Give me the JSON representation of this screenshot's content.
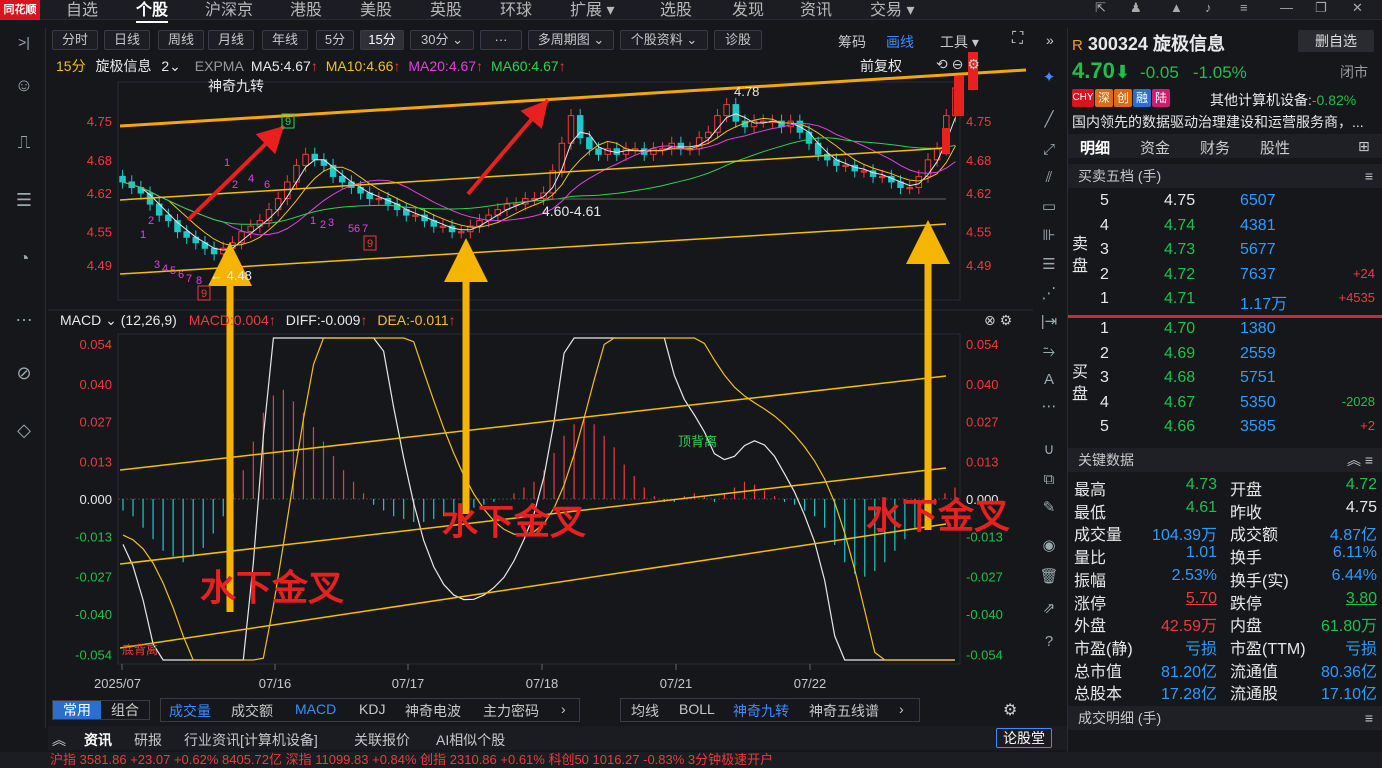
{
  "app": {
    "logo": "同花顺",
    "nav_tabs": [
      "自选",
      "个股",
      "沪深京",
      "港股",
      "美股",
      "英股",
      "环球",
      "扩展",
      "选股",
      "发现",
      "资讯",
      "交易"
    ],
    "active_nav": "个股"
  },
  "toolbar": {
    "periods": [
      "分时",
      "日线",
      "周线",
      "月线",
      "年线",
      "5分",
      "15分",
      "30分",
      "多周期图",
      "个股资料",
      "诊股"
    ],
    "active_period": "15分",
    "right_items": [
      "筹码",
      "画线",
      "工具"
    ]
  },
  "chart_header": {
    "period": "15分",
    "name": "旋极信息",
    "count": "2",
    "indicator": "EXPMA",
    "ma5": "MA5:4.67",
    "ma10": "MA10:4.66",
    "ma20": "MA20:4.67",
    "ma60": "MA60:4.67",
    "adjust": "前复权",
    "sub_indicator": "神奇九转"
  },
  "macd_header": {
    "name": "MACD",
    "params": "(12,26,9)",
    "macd": "MACD:0.004",
    "diff": "DIFF:-0.009",
    "dea": "DEA:-0.011"
  },
  "chart_data": {
    "type": "candlestick",
    "price_axis": [
      "4.75",
      "4.68",
      "4.62",
      "4.55",
      "4.49"
    ],
    "price_range": [
      4.43,
      4.81
    ],
    "macd_axis": [
      "0.054",
      "0.040",
      "0.027",
      "0.013",
      "0.000",
      "-0.013",
      "-0.027",
      "-0.040",
      "-0.054"
    ],
    "macd_range": [
      -0.056,
      0.056
    ],
    "x_labels": [
      "2025/07",
      "07/16",
      "07/17",
      "07/18",
      "07/21",
      "07/22"
    ],
    "annotations": {
      "high_label": "4.78",
      "low_label": "4.48",
      "support_label": "4.60-4.61",
      "golden_cross_1": "水下金叉",
      "golden_cross_2": "水下金叉",
      "golden_cross_3": "水下金叉",
      "top_divergence": "顶背离",
      "bottom_divergence": "底背离"
    },
    "closes": [
      4.64,
      4.63,
      4.62,
      4.6,
      4.58,
      4.57,
      4.55,
      4.54,
      4.53,
      4.52,
      4.51,
      4.52,
      4.53,
      4.55,
      4.56,
      4.57,
      4.59,
      4.61,
      4.64,
      4.67,
      4.69,
      4.68,
      4.67,
      4.65,
      4.64,
      4.63,
      4.62,
      4.61,
      4.61,
      4.6,
      4.59,
      4.58,
      4.58,
      4.57,
      4.56,
      4.56,
      4.55,
      4.55,
      4.56,
      4.57,
      4.58,
      4.59,
      4.6,
      4.6,
      4.61,
      4.61,
      4.62,
      4.66,
      4.71,
      4.76,
      4.72,
      4.7,
      4.69,
      4.7,
      4.69,
      4.7,
      4.7,
      4.69,
      4.7,
      4.7,
      4.71,
      4.7,
      4.7,
      4.72,
      4.73,
      4.76,
      4.78,
      4.75,
      4.74,
      4.75,
      4.75,
      4.75,
      4.74,
      4.75,
      4.73,
      4.71,
      4.69,
      4.68,
      4.67,
      4.67,
      4.66,
      4.66,
      4.65,
      4.65,
      4.64,
      4.63,
      4.63,
      4.65,
      4.68,
      4.7,
      4.76,
      4.81
    ],
    "macd_hist": [
      -0.004,
      -0.006,
      -0.01,
      -0.014,
      -0.018,
      -0.02,
      -0.022,
      -0.02,
      -0.017,
      -0.012,
      -0.006,
      0.002,
      0.01,
      0.02,
      0.03,
      0.036,
      0.038,
      0.034,
      0.03,
      0.025,
      0.02,
      0.015,
      0.01,
      0.006,
      0.002,
      -0.002,
      -0.004,
      -0.006,
      -0.007,
      -0.008,
      -0.008,
      -0.007,
      -0.006,
      -0.005,
      -0.004,
      -0.003,
      -0.002,
      -0.001,
      0.0,
      0.002,
      0.004,
      0.006,
      0.01,
      0.016,
      0.022,
      0.026,
      0.028,
      0.026,
      0.022,
      0.018,
      0.012,
      0.008,
      0.004,
      0.001,
      -0.001,
      -0.001,
      0.001,
      0.002,
      0.001,
      -0.001,
      0.002,
      0.004,
      0.006,
      0.005,
      0.003,
      0.001,
      -0.001,
      -0.002,
      -0.004,
      -0.006,
      -0.01,
      -0.016,
      -0.022,
      -0.026,
      -0.027,
      -0.025,
      -0.022,
      -0.018,
      -0.014,
      -0.01,
      -0.006,
      -0.002,
      0.002,
      0.004
    ]
  },
  "panel": {
    "code": "300324",
    "name": "旋极信息",
    "prefix": "R",
    "delete_btn": "删自选",
    "price": "4.70",
    "change": "-0.05",
    "change_pct": "-1.05%",
    "status": "闭市",
    "tags": [
      "CHY",
      "深",
      "创",
      "融",
      "陆"
    ],
    "sector": "其他计算机设备:",
    "sector_pct": "-0.82%",
    "desc": "国内领先的数据驱动治理建设和运营服务商，...",
    "tabs": [
      "明细",
      "资金",
      "财务",
      "股性"
    ],
    "order_title": "买卖五档 (手)",
    "sell_label": "卖盘",
    "buy_label": "买盘",
    "sells": [
      {
        "lvl": "5",
        "price": "4.75",
        "vol": "6507",
        "chg": ""
      },
      {
        "lvl": "4",
        "price": "4.74",
        "vol": "4381",
        "chg": ""
      },
      {
        "lvl": "3",
        "price": "4.73",
        "vol": "5677",
        "chg": ""
      },
      {
        "lvl": "2",
        "price": "4.72",
        "vol": "7637",
        "chg": "+24"
      },
      {
        "lvl": "1",
        "price": "4.71",
        "vol": "1.17万",
        "chg": "+4535"
      }
    ],
    "buys": [
      {
        "lvl": "1",
        "price": "4.70",
        "vol": "1380",
        "chg": ""
      },
      {
        "lvl": "2",
        "price": "4.69",
        "vol": "2559",
        "chg": ""
      },
      {
        "lvl": "3",
        "price": "4.68",
        "vol": "5751",
        "chg": ""
      },
      {
        "lvl": "4",
        "price": "4.67",
        "vol": "5350",
        "chg": "-2028"
      },
      {
        "lvl": "5",
        "price": "4.66",
        "vol": "3585",
        "chg": "+2"
      }
    ],
    "key_title": "关键数据",
    "key_data": [
      [
        "最高",
        "4.73",
        "开盘",
        "4.72"
      ],
      [
        "最低",
        "4.61",
        "昨收",
        "4.75"
      ],
      [
        "成交量",
        "104.39万",
        "成交额",
        "4.87亿"
      ],
      [
        "量比",
        "1.01",
        "换手",
        "6.11%"
      ],
      [
        "振幅",
        "2.53%",
        "换手(实)",
        "6.44%"
      ],
      [
        "涨停",
        "5.70",
        "跌停",
        "3.80"
      ],
      [
        "外盘",
        "42.59万",
        "内盘",
        "61.80万"
      ],
      [
        "市盈(静)",
        "亏损",
        "市盈(TTM)",
        "亏损"
      ],
      [
        "总市值",
        "81.20亿",
        "流通值",
        "80.36亿"
      ],
      [
        "总股本",
        "17.28亿",
        "流通股",
        "17.10亿"
      ]
    ],
    "trade_title": "成交明细 (手)"
  },
  "bottom": {
    "tabs1": [
      "常用",
      "组合"
    ],
    "tabs2": [
      "成交量",
      "成交额",
      "MACD",
      "KDJ",
      "神奇电波",
      "主力密码"
    ],
    "tabs3": [
      "均线",
      "BOLL",
      "神奇九转",
      "神奇五线谱"
    ],
    "news_tabs": [
      "资讯",
      "研报",
      "行业资讯[计算机设备]",
      "关联报价",
      "AI相似个股"
    ],
    "news_btn": "论股堂"
  },
  "ticker": "沪指 3581.86 +23.07 +0.62% 8405.72亿   深指 11099.83 +0.84%   创指 2310.86 +0.61%   科创50 1016.27 -0.83%   3分钟极速开户"
}
